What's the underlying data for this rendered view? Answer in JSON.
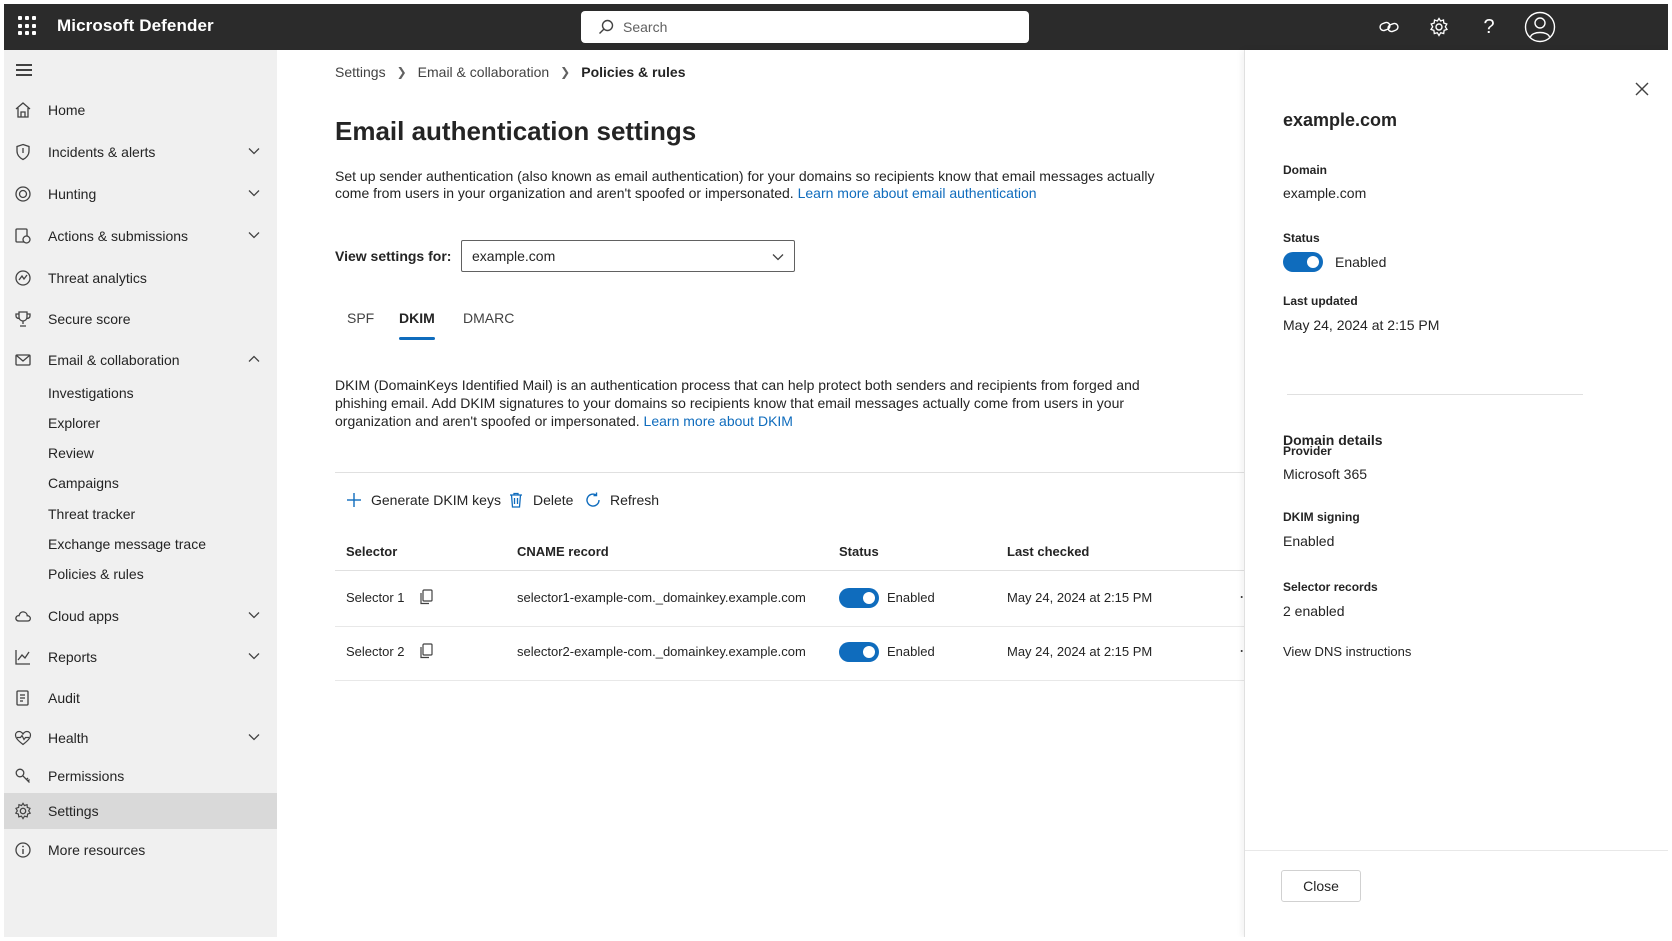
{
  "topbar": {
    "app_title": "Microsoft Defender",
    "search_placeholder": "Search",
    "icons": [
      "waffle-icon",
      "search-icon",
      "link-icon",
      "gear-icon",
      "help-icon",
      "account-icon"
    ]
  },
  "nav": {
    "items": [
      {
        "label": "Home",
        "icon": "home-icon"
      },
      {
        "label": "Incidents & alerts",
        "icon": "shield-icon"
      },
      {
        "label": "Hunting",
        "icon": "target-icon"
      },
      {
        "label": "Actions & submissions",
        "icon": "actions-icon"
      },
      {
        "label": "Threat analytics",
        "icon": "analytics-icon"
      },
      {
        "label": "Secure score",
        "icon": "trophy-icon"
      },
      {
        "label": "Email & collaboration",
        "icon": "mail-icon"
      },
      {
        "label": "Cloud apps",
        "icon": "cloud-icon"
      },
      {
        "label": "Reports",
        "icon": "chart-icon"
      },
      {
        "label": "Audit",
        "icon": "audit-icon"
      },
      {
        "label": "Health",
        "icon": "heart-icon"
      },
      {
        "label": "Permissions",
        "icon": "key-icon"
      },
      {
        "label": "Settings",
        "icon": "gear-icon"
      },
      {
        "label": "More resources",
        "icon": "info-icon"
      }
    ],
    "email_sub": [
      "Investigations",
      "Explorer",
      "Review",
      "Campaigns",
      "Threat tracker",
      "Exchange message trace",
      "Policies & rules"
    ]
  },
  "breadcrumb": [
    "Settings",
    "Email & collaboration",
    "Policies & rules"
  ],
  "main": {
    "title": "Email authentication settings",
    "description": "Set up sender authentication (also known as email authentication) for your domains so recipients know that email messages actually come from users in your organization and aren't spoofed or impersonated.",
    "description_link": "Learn more about email authentication",
    "view_label": "View settings for:",
    "domain_select": "example.com",
    "tabs": [
      "SPF",
      "DKIM",
      "DMARC"
    ],
    "dkim_description": "DKIM (DomainKeys Identified Mail) is an authentication process that can help protect both senders and recipients from forged and phishing email. Add DKIM signatures to your domains so recipients know that email messages actually come from users in your organization and aren't spoofed or impersonated.",
    "dkim_link": "Learn more about DKIM",
    "commands": {
      "generate": "Generate DKIM keys",
      "delete": "Delete",
      "refresh": "Refresh"
    },
    "table": {
      "headers": [
        "Selector",
        "CNAME record",
        "Status",
        "Last checked"
      ],
      "rows": [
        {
          "selector": "Selector 1",
          "cname": "selector1-example-com._domainkey.example.com",
          "status": "Enabled",
          "checked": "May 24, 2024 at 2:15 PM",
          "more": "⋯"
        },
        {
          "selector": "Selector 2",
          "cname": "selector2-example-com._domainkey.example.com",
          "status": "Enabled",
          "checked": "May 24, 2024 at 2:15 PM",
          "more": "⋯"
        }
      ]
    }
  },
  "panel": {
    "title": "example.com",
    "domain_label": "Domain",
    "domain_value": "example.com",
    "status_label": "Status",
    "status_value": "Enabled",
    "updated_label": "Last updated",
    "updated_value": "May 24, 2024 at 2:15 PM",
    "details_title": "Domain details",
    "provider_label": "Provider",
    "provider_value": "Microsoft 365",
    "signing_label": "DKIM signing",
    "signing_value": "Enabled",
    "records_label": "Selector records",
    "records_value": "2 enabled",
    "dns_link": "View DNS instructions",
    "close_button": "Close"
  },
  "colors": {
    "accent": "#0f6cbd",
    "topbar": "#2b2b2b",
    "nav_bg": "#f0f0f0",
    "nav_selected": "#d9d9d9"
  }
}
